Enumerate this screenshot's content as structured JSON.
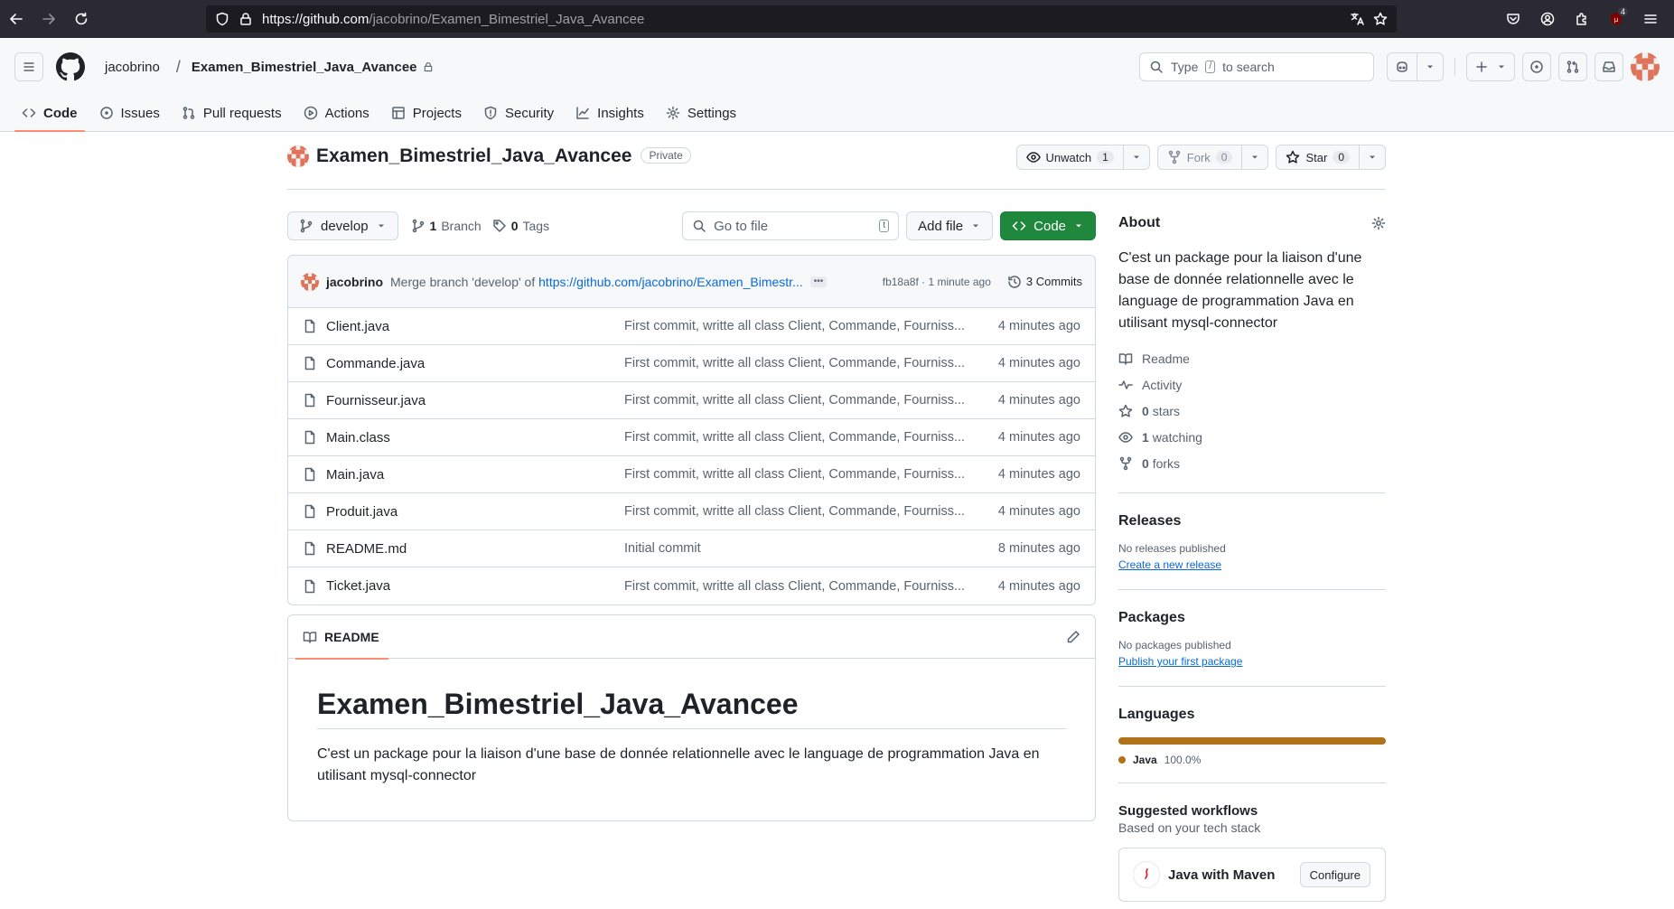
{
  "browser": {
    "url_host": "https://github.com",
    "url_path": "/jacobrino/Examen_Bimestriel_Java_Avancee",
    "extension_badge": "4"
  },
  "header": {
    "owner": "jacobrino",
    "separator": "/",
    "repo": "Examen_Bimestriel_Java_Avancee",
    "search_pre": "Type",
    "search_key": "/",
    "search_post": "to search"
  },
  "tabs": [
    {
      "label": "Code",
      "icon": "code-icon"
    },
    {
      "label": "Issues",
      "icon": "issue-icon"
    },
    {
      "label": "Pull requests",
      "icon": "pull-request-icon"
    },
    {
      "label": "Actions",
      "icon": "play-icon"
    },
    {
      "label": "Projects",
      "icon": "table-icon"
    },
    {
      "label": "Security",
      "icon": "shield-icon"
    },
    {
      "label": "Insights",
      "icon": "graph-icon"
    },
    {
      "label": "Settings",
      "icon": "gear-icon"
    }
  ],
  "repo": {
    "name": "Examen_Bimestriel_Java_Avancee",
    "visibility": "Private",
    "watch_label": "Unwatch",
    "watch_count": "1",
    "fork_label": "Fork",
    "fork_count": "0",
    "star_label": "Star",
    "star_count": "0"
  },
  "toolbar": {
    "branch": "develop",
    "branch_count": "1",
    "branch_label": "Branch",
    "tag_count": "0",
    "tag_label": "Tags",
    "goto_placeholder": "Go to file",
    "goto_key": "t",
    "add_file": "Add file",
    "code": "Code"
  },
  "last_commit": {
    "author": "jacobrino",
    "message_prefix": "Merge branch 'develop' of ",
    "message_link": "https://github.com/jacobrino/Examen_Bimestr...",
    "ellipsis": "•••",
    "sha": "fb18a8f",
    "dot": "·",
    "age": "1 minute ago",
    "commits": "3 Commits"
  },
  "files": [
    {
      "name": "Client.java",
      "message": "First commit, writte all class Client, Commande, Fourniss...",
      "age": "4 minutes ago"
    },
    {
      "name": "Commande.java",
      "message": "First commit, writte all class Client, Commande, Fourniss...",
      "age": "4 minutes ago"
    },
    {
      "name": "Fournisseur.java",
      "message": "First commit, writte all class Client, Commande, Fourniss...",
      "age": "4 minutes ago"
    },
    {
      "name": "Main.class",
      "message": "First commit, writte all class Client, Commande, Fourniss...",
      "age": "4 minutes ago"
    },
    {
      "name": "Main.java",
      "message": "First commit, writte all class Client, Commande, Fourniss...",
      "age": "4 minutes ago"
    },
    {
      "name": "Produit.java",
      "message": "First commit, writte all class Client, Commande, Fourniss...",
      "age": "4 minutes ago"
    },
    {
      "name": "README.md",
      "message": "Initial commit",
      "age": "8 minutes ago"
    },
    {
      "name": "Ticket.java",
      "message": "First commit, writte all class Client, Commande, Fourniss...",
      "age": "4 minutes ago"
    }
  ],
  "readme": {
    "tab": "README",
    "title": "Examen_Bimestriel_Java_Avancee",
    "body": "C'est un package pour la liaison d'une base de donnée relationnelle avec le language de programmation Java en utilisant mysql-connector"
  },
  "about": {
    "title": "About",
    "description": "C'est un package pour la liaison d'une base de donnée relationnelle avec le language de programmation Java en utilisant mysql-connector",
    "readme": "Readme",
    "activity": "Activity",
    "stars_count": "0",
    "stars_label": "stars",
    "watching_count": "1",
    "watching_label": "watching",
    "forks_count": "0",
    "forks_label": "forks"
  },
  "releases": {
    "title": "Releases",
    "empty": "No releases published",
    "link": "Create a new release"
  },
  "packages": {
    "title": "Packages",
    "empty": "No packages published",
    "link": "Publish your first package"
  },
  "languages": {
    "title": "Languages",
    "items": [
      {
        "name": "Java",
        "percent": "100.0%",
        "share": 1.0,
        "color": "#b07219"
      }
    ]
  },
  "workflows": {
    "title": "Suggested workflows",
    "subtitle": "Based on your tech stack",
    "card_name": "Java with Maven",
    "card_button": "Configure"
  },
  "colors": {
    "accent_tab": "#fd8c73",
    "green_button": "#1f883d",
    "link": "#0969da"
  }
}
